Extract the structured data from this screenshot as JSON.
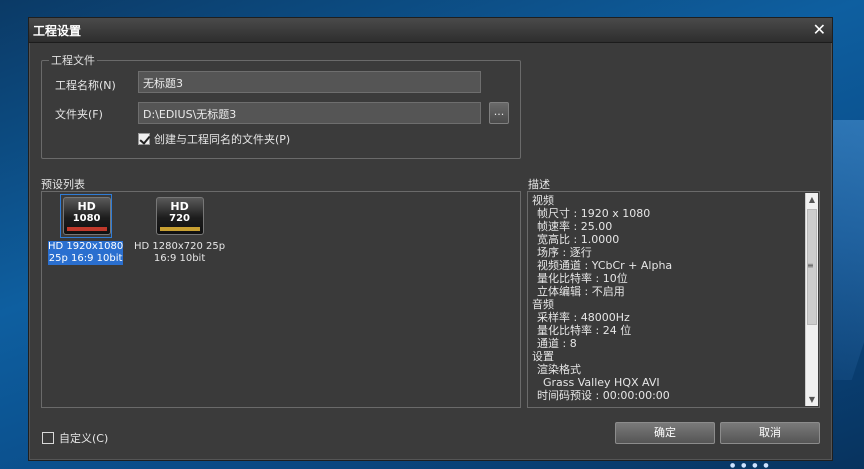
{
  "dialog": {
    "title": "工程设置",
    "close_glyph": "✕"
  },
  "project_file": {
    "group_label": "工程文件",
    "name_label": "工程名称(N)",
    "name_value": "无标题3",
    "folder_label": "文件夹(F)",
    "folder_value": "D:\\EDIUS\\无标题3",
    "browse_label": "...",
    "create_folder_label": "创建与工程同名的文件夹(P)",
    "create_folder_checked": true
  },
  "preset_list": {
    "label": "预设列表",
    "items": [
      {
        "icon": "hd-1080-icon",
        "icon_top": "HD",
        "icon_bottom": "1080",
        "icon_bar_color": "#c0392b",
        "line1": "HD 1920x1080",
        "line2": "25p 16:9 10bit",
        "selected": true
      },
      {
        "icon": "hd-720-icon",
        "icon_top": "HD",
        "icon_bottom": "720",
        "icon_bar_color": "#c8a032",
        "line1": "HD 1280x720 25p",
        "line2": "16:9 10bit",
        "selected": false
      }
    ]
  },
  "description": {
    "label": "描述",
    "lines": [
      {
        "text": "视频",
        "level": 0
      },
      {
        "text": "帧尺寸 : 1920 x 1080",
        "level": 1
      },
      {
        "text": "帧速率 : 25.00",
        "level": 1
      },
      {
        "text": "宽高比 : 1.0000",
        "level": 1
      },
      {
        "text": "场序 : 逐行",
        "level": 1
      },
      {
        "text": "视频通道 : YCbCr + Alpha",
        "level": 1
      },
      {
        "text": "量化比特率 : 10位",
        "level": 1
      },
      {
        "text": "立体编辑 : 不启用",
        "level": 1
      },
      {
        "text": "音频",
        "level": 0
      },
      {
        "text": "采样率 : 48000Hz",
        "level": 1
      },
      {
        "text": "量化比特率 : 24 位",
        "level": 1
      },
      {
        "text": "通道 : 8",
        "level": 1
      },
      {
        "text": "设置",
        "level": 0
      },
      {
        "text": "渲染格式",
        "level": 1
      },
      {
        "text": "Grass Valley HQX AVI",
        "level": 2
      },
      {
        "text": "时间码预设 : 00:00:00:00",
        "level": 1
      }
    ]
  },
  "footer": {
    "custom_label": "自定义(C)",
    "custom_checked": false,
    "ok_label": "确定",
    "cancel_label": "取消"
  }
}
